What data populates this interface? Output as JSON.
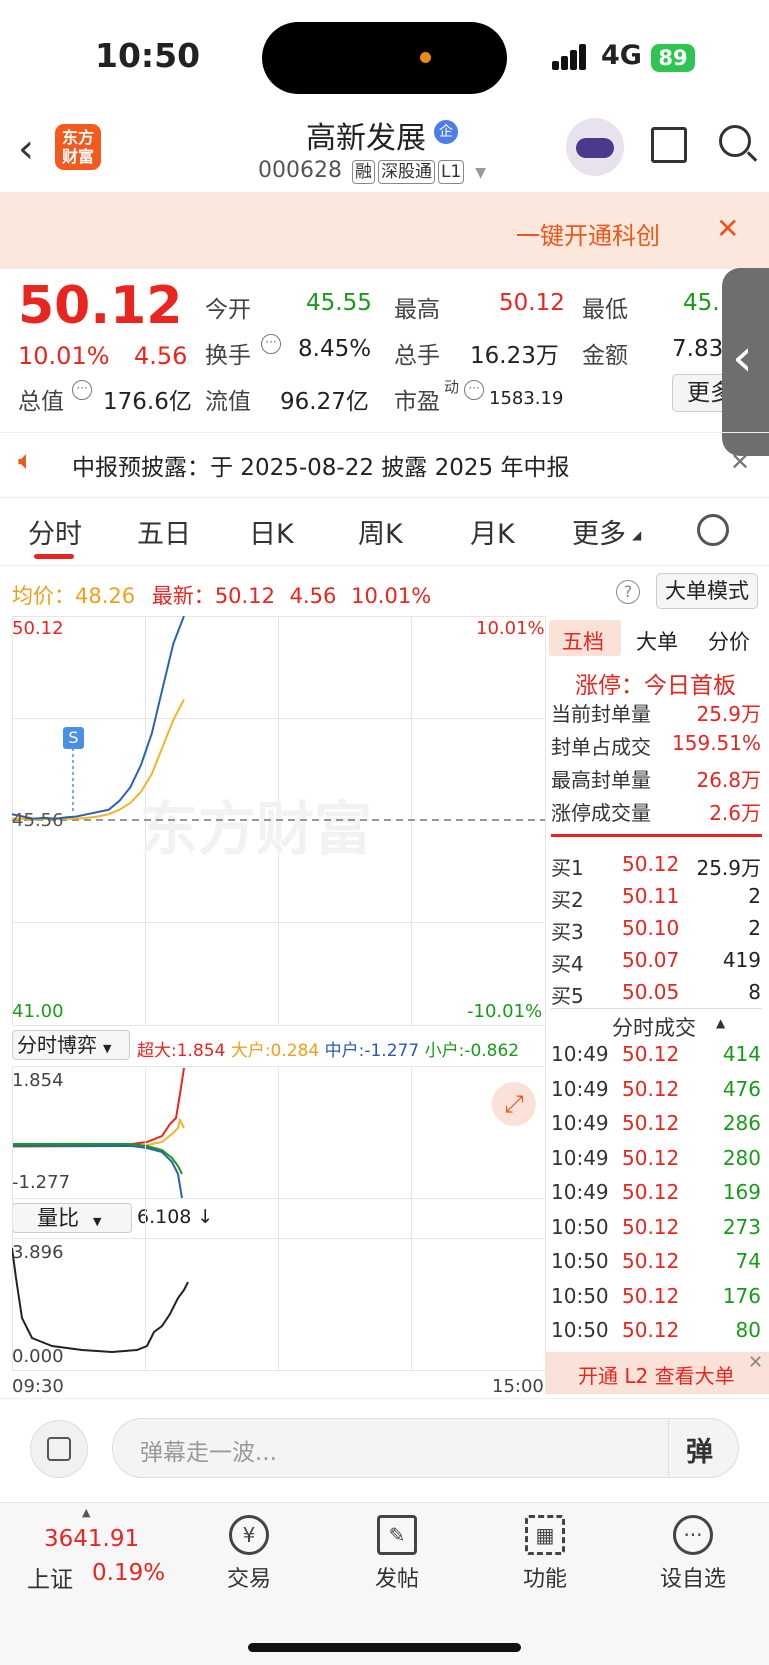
{
  "status": {
    "time": "10:50",
    "network": "4G",
    "battery": "89"
  },
  "header": {
    "title": "高新发展",
    "badge": "企",
    "code": "000628",
    "tags": [
      "融",
      "深股通",
      "L1"
    ],
    "logo": "东方财富"
  },
  "banner": {
    "text": "一键开通科创"
  },
  "quote": {
    "price": "50.12",
    "pct": "10.01%",
    "chg": "4.56",
    "open_l": "今开",
    "open": "45.55",
    "high_l": "最高",
    "high": "50.12",
    "low_l": "最低",
    "low": "45.",
    "turn_l": "换手",
    "turn": "8.45%",
    "vol_l": "总手",
    "vol": "16.23万",
    "amt_l": "金额",
    "amt": "7.83",
    "cap_l": "总值",
    "cap": "176.6亿",
    "fcap_l": "流值",
    "fcap": "96.27亿",
    "pe_l": "市盈",
    "pe_sup": "动",
    "pe": "1583.19",
    "more": "更多"
  },
  "notice": {
    "text": "中报预披露：于 2025-08-22 披露 2025 年中报"
  },
  "tabs": [
    "分时",
    "五日",
    "日K",
    "周K",
    "月K",
    "更多"
  ],
  "infoline": {
    "avg_l": "均价：",
    "avg": "48.26",
    "last_l": "最新：",
    "last": "50.12",
    "chg": "4.56",
    "pct": "10.01%",
    "mode": "大单模式"
  },
  "chart": {
    "y_top": "50.12",
    "y_mid": "45.56",
    "y_bot": "41.00",
    "pct_top": "10.01%",
    "pct_bot": "-10.01%",
    "marker": "S",
    "watermark": "东方财富",
    "t_start": "09:30",
    "t_end": "15:00"
  },
  "chart_data": {
    "type": "line",
    "x_range": [
      "09:30",
      "15:00"
    ],
    "ylim": [
      41.0,
      50.12
    ],
    "series": [
      {
        "name": "价格",
        "values": [
          45.7,
          45.65,
          45.6,
          45.62,
          45.6,
          45.63,
          45.65,
          45.7,
          45.75,
          45.8,
          46.0,
          46.3,
          46.8,
          47.5,
          48.5,
          49.5,
          50.12
        ]
      },
      {
        "name": "均价",
        "values": [
          45.6,
          45.6,
          45.58,
          45.6,
          45.6,
          45.6,
          45.6,
          45.62,
          45.65,
          45.7,
          45.8,
          45.95,
          46.2,
          46.6,
          47.2,
          47.8,
          48.26
        ]
      }
    ]
  },
  "flow": {
    "title": "分时博弈",
    "super_l": "超大",
    "super": "1.854",
    "big_l": "大户",
    "big": "0.284",
    "mid_l": "中户",
    "mid": "-1.277",
    "small_l": "小户",
    "small": "-0.862",
    "y_top": "1.854",
    "y_bot": "-1.277"
  },
  "ratio": {
    "title": "量比",
    "value": "6.108 ↓",
    "y_top": "3.896",
    "y_bot": "0.000"
  },
  "right": {
    "tabs": [
      "五档",
      "大单",
      "分价"
    ],
    "limit_title": "涨停：今日首板",
    "stats": [
      {
        "label": "当前封单量",
        "value": "25.9万"
      },
      {
        "label": "封单占成交",
        "value": "159.51%"
      },
      {
        "label": "最高封单量",
        "value": "26.8万"
      },
      {
        "label": "涨停成交量",
        "value": "2.6万"
      }
    ],
    "bids": [
      {
        "label": "买1",
        "price": "50.12",
        "vol": "25.9万"
      },
      {
        "label": "买2",
        "price": "50.11",
        "vol": "2"
      },
      {
        "label": "买3",
        "price": "50.10",
        "vol": "2"
      },
      {
        "label": "买4",
        "price": "50.07",
        "vol": "419"
      },
      {
        "label": "买5",
        "price": "50.05",
        "vol": "8"
      }
    ],
    "trades_title": "分时成交",
    "trades": [
      {
        "t": "10:49",
        "p": "50.12",
        "v": "414"
      },
      {
        "t": "10:49",
        "p": "50.12",
        "v": "476"
      },
      {
        "t": "10:49",
        "p": "50.12",
        "v": "286"
      },
      {
        "t": "10:49",
        "p": "50.12",
        "v": "280"
      },
      {
        "t": "10:49",
        "p": "50.12",
        "v": "169"
      },
      {
        "t": "10:50",
        "p": "50.12",
        "v": "273"
      },
      {
        "t": "10:50",
        "p": "50.12",
        "v": "74"
      },
      {
        "t": "10:50",
        "p": "50.12",
        "v": "176"
      },
      {
        "t": "10:50",
        "p": "50.12",
        "v": "80"
      }
    ],
    "l2": "开通 L2 查看大单"
  },
  "comment": {
    "placeholder": "弹幕走一波...",
    "btn": "弹"
  },
  "bottom": {
    "index_val": "3641.91",
    "index_name": "上证",
    "index_pct": "0.19%",
    "items": [
      "交易",
      "发帖",
      "功能",
      "设自选"
    ]
  }
}
